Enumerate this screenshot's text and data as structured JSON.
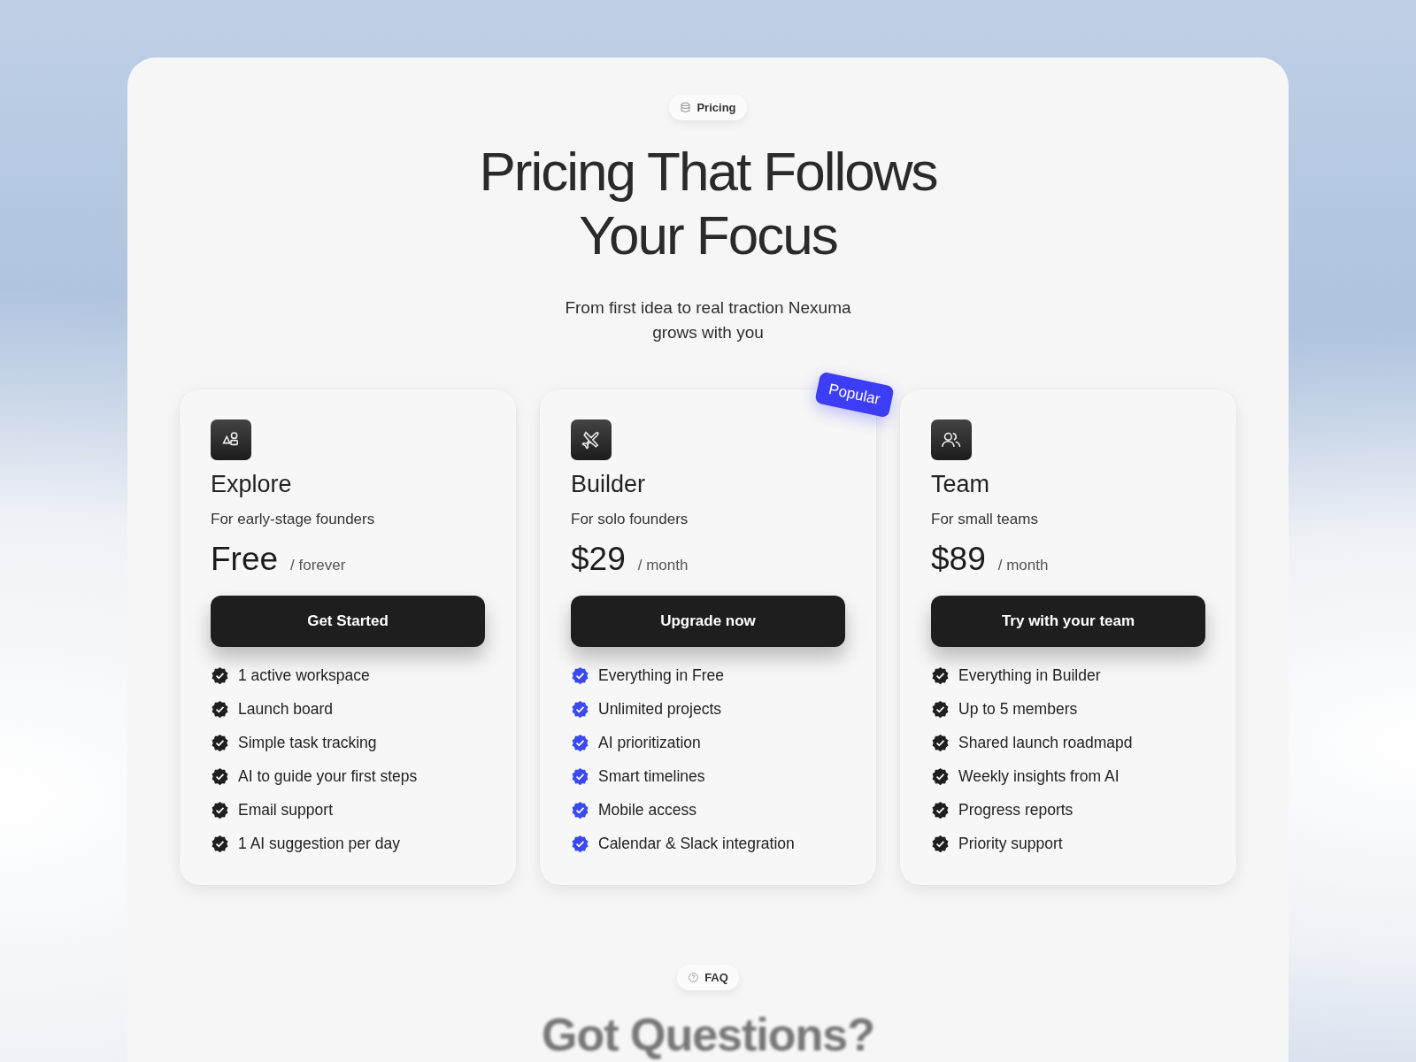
{
  "section_tag": {
    "label": "Pricing"
  },
  "headline": [
    "Pricing That Follows",
    "Your Focus"
  ],
  "subtitle": "From first idea to real traction Nexuma grows with you",
  "plans": [
    {
      "name": "Explore",
      "tagline": "For early-stage founders",
      "price": "Free",
      "period": "/ forever",
      "button": "Get Started",
      "highlighted": false,
      "features": [
        "1 active workspace",
        "Launch board",
        "Simple task tracking",
        "AI to guide your first steps",
        "Email support",
        "1 AI suggestion per day"
      ]
    },
    {
      "name": "Builder",
      "tagline": "For solo founders",
      "price": "$29",
      "period": "/ month",
      "button": "Upgrade now",
      "highlighted": true,
      "badge": "Popular",
      "features": [
        "Everything in Free",
        "Unlimited projects",
        "AI prioritization",
        "Smart timelines",
        "Mobile access",
        "Calendar & Slack integration"
      ]
    },
    {
      "name": "Team",
      "tagline": "For small teams",
      "price": "$89",
      "period": "/ month",
      "button": "Try with your team",
      "highlighted": false,
      "features": [
        "Everything in Builder",
        "Up to 5 members",
        "Shared launch roadmapd",
        "Weekly insights from AI",
        "Progress reports",
        "Priority support"
      ]
    }
  ],
  "faq_tag": {
    "label": "FAQ"
  },
  "faq_heading": "Got Questions?"
}
